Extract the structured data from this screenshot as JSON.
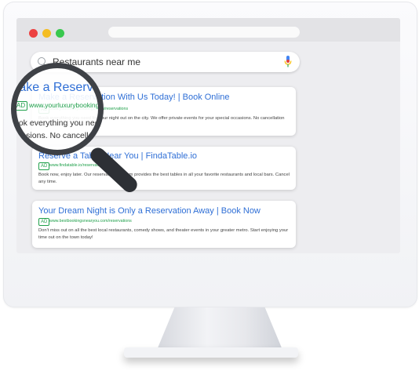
{
  "search": {
    "query": "Restaurants near me"
  },
  "magnifier": {
    "title": "Make a Reservatio",
    "ad_label": "AD",
    "url": "www.yourluxurybookings",
    "desc_line1": "Book everything you need",
    "desc_line2": "occasions. No cancellatio"
  },
  "results": [
    {
      "title": "Make a Reservation With Us Today! | Book Online",
      "ad_label": "AD",
      "url": "www.yourluxurybookings.com/reservations",
      "desc": "Book everything you need for your night out on the city. We offer private events for your special occasions. No cancellation fees ever."
    },
    {
      "title": "Reserve a Table Near You | FindaTable.io",
      "ad_label": "AD",
      "url": "www.findatable.io/reservations",
      "desc": "Book now, enjoy later. Our reservation platform provides the best tables in all your favorite restaurants and local bars. Cancel any time."
    },
    {
      "title": "Your Dream Night is Only a Reservation Away | Book Now",
      "ad_label": "AD",
      "url": "www.bestbookingsnearyou.com/reservations",
      "desc": "Don't miss out on all the best local restaurants, comedy shows, and theater events in your greater metro. Start enjoying your time out on the town today!"
    }
  ],
  "colors": {
    "link_blue": "#2f6fd6",
    "ad_green": "#20a04b",
    "close_dot": "#ec4141",
    "minimize_dot": "#f4bd22",
    "zoom_dot": "#39c84e"
  }
}
